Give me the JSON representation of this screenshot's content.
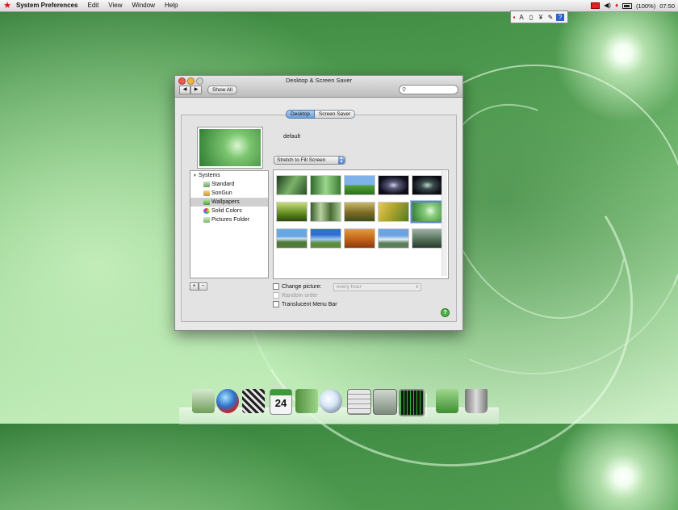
{
  "menubar": {
    "app_name": "System Preferences",
    "items": [
      "Edit",
      "View",
      "Window",
      "Help"
    ],
    "battery": "(100%)",
    "clock": "07:50"
  },
  "input_palette": {
    "icons": [
      "A",
      "▯",
      "¥",
      "✎",
      "?"
    ]
  },
  "window": {
    "title": "Desktop & Screen Saver",
    "show_all": "Show All",
    "search_placeholder": "",
    "tabs": [
      {
        "label": "Desktop",
        "selected": true
      },
      {
        "label": "Screen Saver",
        "selected": false
      }
    ],
    "current_picture_name": "default",
    "fill_mode": "Stretch to Fill Screen",
    "source_group": "Systems",
    "sources": [
      {
        "label": "Standard",
        "selected": false
      },
      {
        "label": "SonGun",
        "selected": false
      },
      {
        "label": "Wallpapers",
        "selected": true
      },
      {
        "label": "Solid Colors",
        "selected": false
      },
      {
        "label": "Pictures Folder",
        "selected": false
      }
    ],
    "add_label": "+",
    "remove_label": "−",
    "change_picture_label": "Change picture:",
    "change_interval": "every hour",
    "random_order_label": "Random order",
    "translucent_menu_bar_label": "Translucent Menu Bar",
    "help_label": "?"
  },
  "dock": {
    "calendar_day": "24",
    "icons": [
      "finder-icon",
      "globe-icon",
      "movie-icon",
      "calendar-icon",
      "address-book-icon",
      "preview-icon",
      "calculator-icon",
      "system-preferences-icon",
      "activity-monitor-icon",
      "downloads-folder-icon",
      "trash-icon"
    ]
  },
  "colors": {
    "accent_blue": "#5f86b6",
    "wallpaper_green": "#5aa85a",
    "menubar_red_star": "#dd1111"
  }
}
